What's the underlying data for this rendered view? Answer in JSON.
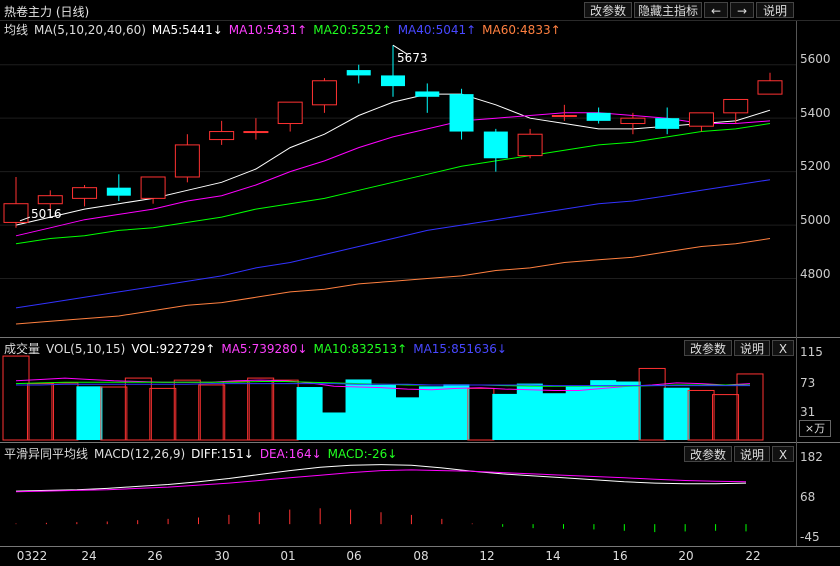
{
  "window": {
    "title": "热卷主力 (日线)",
    "buttons": {
      "change_params": "改参数",
      "hide_indicator": "隐藏主指标",
      "prev": "←",
      "next": "→",
      "help": "说明",
      "close": "X"
    }
  },
  "main_panel": {
    "legend_label": "均线",
    "legend_ma": "MA(5,10,20,40,60)",
    "ma5": "MA5:5441↓",
    "ma10": "MA10:5431↑",
    "ma20": "MA20:5252↑",
    "ma40": "MA40:5041↑",
    "ma60": "MA60:4833↑",
    "annotation_high": "5673",
    "annotation_low": "5016",
    "y_ticks": [
      "5600",
      "5400",
      "5200",
      "5000",
      "4800"
    ]
  },
  "volume_panel": {
    "legend_label": "成交量",
    "legend_params": "VOL(5,10,15)",
    "vol": "VOL:922729↑",
    "ma5": "MA5:739280↓",
    "ma10": "MA10:832513↑",
    "ma15": "MA15:851636↓",
    "y_ticks": [
      "115",
      "73",
      "31"
    ],
    "unit": "×万"
  },
  "macd_panel": {
    "legend_label": "平滑异同平均线",
    "legend_params": "MACD(12,26,9)",
    "diff": "DIFF:151↓",
    "dea": "DEA:164↓",
    "macd": "MACD:-26↓",
    "y_ticks": [
      "182",
      "68",
      "-45"
    ]
  },
  "x_axis": [
    "0322",
    "24",
    "26",
    "30",
    "01",
    "06",
    "08",
    "12",
    "14",
    "16",
    "20",
    "22"
  ],
  "colors": {
    "up": "#ff3232",
    "down": "#00ffff",
    "ma5": "#ffffff",
    "ma10": "#ff00ff",
    "ma20": "#00ff00",
    "ma40": "#3232ff",
    "ma60": "#ff8040"
  },
  "chart_data": [
    {
      "type": "candlestick",
      "title": "热卷主力 (日线)",
      "ylim": [
        4600,
        5700
      ],
      "candles": [
        {
          "o": 5010,
          "c": 5080,
          "h": 5180,
          "l": 4990
        },
        {
          "o": 5080,
          "c": 5110,
          "h": 5130,
          "l": 5050
        },
        {
          "o": 5100,
          "c": 5140,
          "h": 5150,
          "l": 5070
        },
        {
          "o": 5140,
          "c": 5110,
          "h": 5190,
          "l": 5090
        },
        {
          "o": 5100,
          "c": 5180,
          "h": 5180,
          "l": 5080
        },
        {
          "o": 5180,
          "c": 5300,
          "h": 5340,
          "l": 5160
        },
        {
          "o": 5320,
          "c": 5350,
          "h": 5390,
          "l": 5300
        },
        {
          "o": 5350,
          "c": 5350,
          "h": 5400,
          "l": 5320
        },
        {
          "o": 5380,
          "c": 5460,
          "h": 5460,
          "l": 5350
        },
        {
          "o": 5450,
          "c": 5540,
          "h": 5550,
          "l": 5420
        },
        {
          "o": 5580,
          "c": 5560,
          "h": 5600,
          "l": 5530
        },
        {
          "o": 5560,
          "c": 5520,
          "h": 5673,
          "l": 5480
        },
        {
          "o": 5500,
          "c": 5480,
          "h": 5530,
          "l": 5420
        },
        {
          "o": 5490,
          "c": 5350,
          "h": 5510,
          "l": 5320
        },
        {
          "o": 5350,
          "c": 5250,
          "h": 5360,
          "l": 5200
        },
        {
          "o": 5260,
          "c": 5340,
          "h": 5360,
          "l": 5250
        },
        {
          "o": 5410,
          "c": 5410,
          "h": 5450,
          "l": 5390
        },
        {
          "o": 5420,
          "c": 5390,
          "h": 5440,
          "l": 5380
        },
        {
          "o": 5380,
          "c": 5400,
          "h": 5420,
          "l": 5340
        },
        {
          "o": 5400,
          "c": 5360,
          "h": 5440,
          "l": 5340
        },
        {
          "o": 5370,
          "c": 5420,
          "h": 5420,
          "l": 5350
        },
        {
          "o": 5420,
          "c": 5470,
          "h": 5470,
          "l": 5380
        },
        {
          "o": 5490,
          "c": 5540,
          "h": 5570,
          "l": 5490
        }
      ],
      "series": [
        {
          "name": "MA5",
          "values": [
            5000,
            5030,
            5060,
            5080,
            5100,
            5130,
            5160,
            5210,
            5290,
            5340,
            5410,
            5460,
            5490,
            5490,
            5450,
            5400,
            5380,
            5360,
            5360,
            5370,
            5380,
            5390,
            5430
          ]
        },
        {
          "name": "MA10",
          "values": [
            4960,
            4990,
            5020,
            5040,
            5060,
            5090,
            5110,
            5150,
            5200,
            5240,
            5290,
            5330,
            5360,
            5390,
            5400,
            5410,
            5420,
            5420,
            5410,
            5400,
            5380,
            5380,
            5390
          ]
        },
        {
          "name": "MA20",
          "values": [
            4930,
            4950,
            4960,
            4980,
            4990,
            5010,
            5030,
            5060,
            5080,
            5100,
            5130,
            5160,
            5190,
            5220,
            5240,
            5260,
            5280,
            5300,
            5310,
            5330,
            5350,
            5360,
            5380
          ]
        },
        {
          "name": "MA40",
          "values": [
            4690,
            4710,
            4730,
            4750,
            4770,
            4790,
            4810,
            4840,
            4860,
            4890,
            4920,
            4950,
            4980,
            5000,
            5020,
            5040,
            5060,
            5080,
            5090,
            5110,
            5130,
            5150,
            5170
          ]
        },
        {
          "name": "MA60",
          "values": [
            4630,
            4640,
            4650,
            4660,
            4680,
            4700,
            4710,
            4730,
            4750,
            4760,
            4780,
            4790,
            4800,
            4810,
            4830,
            4840,
            4860,
            4870,
            4880,
            4900,
            4920,
            4930,
            4950
          ]
        }
      ]
    },
    {
      "type": "bar",
      "title": "成交量",
      "ylim": [
        0,
        125
      ],
      "values": [
        122,
        82,
        83,
        78,
        77,
        90,
        75,
        87,
        80,
        85,
        90,
        87,
        77,
        40,
        88,
        80,
        62,
        78,
        81,
        75,
        67,
        82,
        68,
        78,
        87,
        85,
        104,
        76,
        72,
        66,
        96
      ],
      "up": [
        true,
        true,
        true,
        false,
        true,
        true,
        true,
        true,
        true,
        true,
        true,
        true,
        false,
        false,
        false,
        false,
        false,
        false,
        false,
        true,
        false,
        false,
        false,
        false,
        false,
        false,
        true,
        false,
        true,
        true,
        true
      ],
      "series": [
        {
          "name": "MA5",
          "values": [
            86,
            88,
            90,
            88,
            86,
            85,
            84,
            84,
            84,
            86,
            87,
            86,
            83,
            78,
            77,
            76,
            74,
            73,
            75,
            76,
            74,
            73,
            72,
            72,
            75,
            78,
            80,
            83,
            82,
            80,
            82
          ]
        },
        {
          "name": "MA10",
          "values": [
            82,
            83,
            84,
            84,
            84,
            84,
            84,
            84,
            84,
            84,
            85,
            85,
            84,
            83,
            82,
            81,
            80,
            80,
            80,
            80,
            79,
            78,
            78,
            78,
            78,
            78,
            79,
            80,
            80,
            80,
            80
          ]
        },
        {
          "name": "MA15",
          "values": [
            80,
            80,
            81,
            81,
            81,
            81,
            81,
            81,
            82,
            82,
            82,
            82,
            82,
            82,
            81,
            81,
            81,
            80,
            80,
            80,
            80,
            80,
            79,
            79,
            79,
            79,
            79,
            79,
            79,
            79,
            79
          ]
        }
      ]
    },
    {
      "type": "line",
      "title": "平滑异同平均线",
      "ylim": [
        -60,
        200
      ],
      "series": [
        {
          "name": "DIFF",
          "values": [
            100,
            102,
            104,
            108,
            114,
            120,
            128,
            138,
            150,
            162,
            172,
            178,
            180,
            178,
            170,
            160,
            152,
            146,
            140,
            134,
            128,
            124,
            122,
            122,
            124
          ]
        },
        {
          "name": "DEA",
          "values": [
            98,
            100,
            102,
            104,
            108,
            112,
            118,
            124,
            132,
            140,
            148,
            156,
            162,
            164,
            162,
            160,
            156,
            152,
            148,
            144,
            140,
            136,
            132,
            130,
            128
          ]
        },
        {
          "name": "MACD",
          "values": [
            2,
            4,
            6,
            8,
            12,
            16,
            20,
            28,
            36,
            44,
            48,
            44,
            36,
            28,
            16,
            2,
            -8,
            -12,
            -14,
            -16,
            -20,
            -24,
            -22,
            -20,
            -22
          ]
        }
      ]
    }
  ]
}
